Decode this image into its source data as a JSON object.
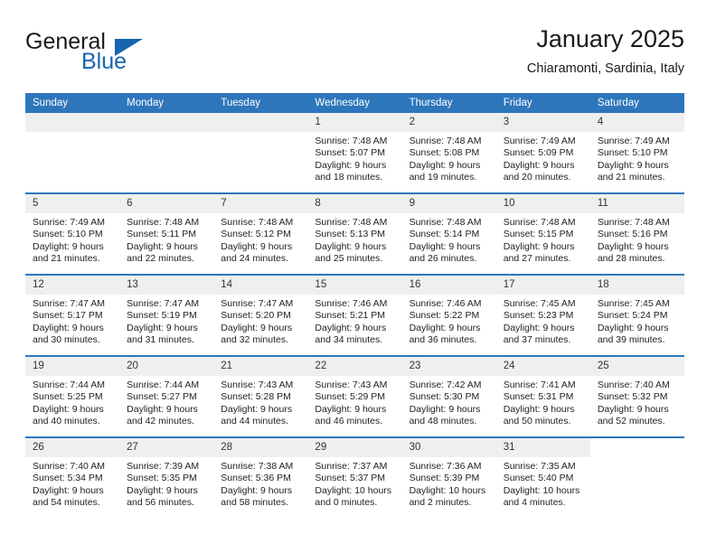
{
  "brand": {
    "name_part1": "General",
    "name_part2": "Blue",
    "accent_color": "#1565b0",
    "triangle_icon": "triangle-icon"
  },
  "header": {
    "month_title": "January 2025",
    "location": "Chiaramonti, Sardinia, Italy"
  },
  "theme": {
    "header_row_color": "#2e76bc",
    "day_band_color": "#efefef",
    "row_divider_color": "#2e76bc",
    "text_color": "#222222"
  },
  "weekday_headers": [
    "Sunday",
    "Monday",
    "Tuesday",
    "Wednesday",
    "Thursday",
    "Friday",
    "Saturday"
  ],
  "weeks": [
    [
      {
        "day": "",
        "blank": true,
        "sunrise": "",
        "sunset": "",
        "daylight_line1": "",
        "daylight_line2": ""
      },
      {
        "day": "",
        "blank": true,
        "sunrise": "",
        "sunset": "",
        "daylight_line1": "",
        "daylight_line2": ""
      },
      {
        "day": "",
        "blank": true,
        "sunrise": "",
        "sunset": "",
        "daylight_line1": "",
        "daylight_line2": ""
      },
      {
        "day": "1",
        "sunrise": "Sunrise: 7:48 AM",
        "sunset": "Sunset: 5:07 PM",
        "daylight_line1": "Daylight: 9 hours",
        "daylight_line2": "and 18 minutes."
      },
      {
        "day": "2",
        "sunrise": "Sunrise: 7:48 AM",
        "sunset": "Sunset: 5:08 PM",
        "daylight_line1": "Daylight: 9 hours",
        "daylight_line2": "and 19 minutes."
      },
      {
        "day": "3",
        "sunrise": "Sunrise: 7:49 AM",
        "sunset": "Sunset: 5:09 PM",
        "daylight_line1": "Daylight: 9 hours",
        "daylight_line2": "and 20 minutes."
      },
      {
        "day": "4",
        "sunrise": "Sunrise: 7:49 AM",
        "sunset": "Sunset: 5:10 PM",
        "daylight_line1": "Daylight: 9 hours",
        "daylight_line2": "and 21 minutes."
      }
    ],
    [
      {
        "day": "5",
        "sunrise": "Sunrise: 7:49 AM",
        "sunset": "Sunset: 5:10 PM",
        "daylight_line1": "Daylight: 9 hours",
        "daylight_line2": "and 21 minutes."
      },
      {
        "day": "6",
        "sunrise": "Sunrise: 7:48 AM",
        "sunset": "Sunset: 5:11 PM",
        "daylight_line1": "Daylight: 9 hours",
        "daylight_line2": "and 22 minutes."
      },
      {
        "day": "7",
        "sunrise": "Sunrise: 7:48 AM",
        "sunset": "Sunset: 5:12 PM",
        "daylight_line1": "Daylight: 9 hours",
        "daylight_line2": "and 24 minutes."
      },
      {
        "day": "8",
        "sunrise": "Sunrise: 7:48 AM",
        "sunset": "Sunset: 5:13 PM",
        "daylight_line1": "Daylight: 9 hours",
        "daylight_line2": "and 25 minutes."
      },
      {
        "day": "9",
        "sunrise": "Sunrise: 7:48 AM",
        "sunset": "Sunset: 5:14 PM",
        "daylight_line1": "Daylight: 9 hours",
        "daylight_line2": "and 26 minutes."
      },
      {
        "day": "10",
        "sunrise": "Sunrise: 7:48 AM",
        "sunset": "Sunset: 5:15 PM",
        "daylight_line1": "Daylight: 9 hours",
        "daylight_line2": "and 27 minutes."
      },
      {
        "day": "11",
        "sunrise": "Sunrise: 7:48 AM",
        "sunset": "Sunset: 5:16 PM",
        "daylight_line1": "Daylight: 9 hours",
        "daylight_line2": "and 28 minutes."
      }
    ],
    [
      {
        "day": "12",
        "sunrise": "Sunrise: 7:47 AM",
        "sunset": "Sunset: 5:17 PM",
        "daylight_line1": "Daylight: 9 hours",
        "daylight_line2": "and 30 minutes."
      },
      {
        "day": "13",
        "sunrise": "Sunrise: 7:47 AM",
        "sunset": "Sunset: 5:19 PM",
        "daylight_line1": "Daylight: 9 hours",
        "daylight_line2": "and 31 minutes."
      },
      {
        "day": "14",
        "sunrise": "Sunrise: 7:47 AM",
        "sunset": "Sunset: 5:20 PM",
        "daylight_line1": "Daylight: 9 hours",
        "daylight_line2": "and 32 minutes."
      },
      {
        "day": "15",
        "sunrise": "Sunrise: 7:46 AM",
        "sunset": "Sunset: 5:21 PM",
        "daylight_line1": "Daylight: 9 hours",
        "daylight_line2": "and 34 minutes."
      },
      {
        "day": "16",
        "sunrise": "Sunrise: 7:46 AM",
        "sunset": "Sunset: 5:22 PM",
        "daylight_line1": "Daylight: 9 hours",
        "daylight_line2": "and 36 minutes."
      },
      {
        "day": "17",
        "sunrise": "Sunrise: 7:45 AM",
        "sunset": "Sunset: 5:23 PM",
        "daylight_line1": "Daylight: 9 hours",
        "daylight_line2": "and 37 minutes."
      },
      {
        "day": "18",
        "sunrise": "Sunrise: 7:45 AM",
        "sunset": "Sunset: 5:24 PM",
        "daylight_line1": "Daylight: 9 hours",
        "daylight_line2": "and 39 minutes."
      }
    ],
    [
      {
        "day": "19",
        "sunrise": "Sunrise: 7:44 AM",
        "sunset": "Sunset: 5:25 PM",
        "daylight_line1": "Daylight: 9 hours",
        "daylight_line2": "and 40 minutes."
      },
      {
        "day": "20",
        "sunrise": "Sunrise: 7:44 AM",
        "sunset": "Sunset: 5:27 PM",
        "daylight_line1": "Daylight: 9 hours",
        "daylight_line2": "and 42 minutes."
      },
      {
        "day": "21",
        "sunrise": "Sunrise: 7:43 AM",
        "sunset": "Sunset: 5:28 PM",
        "daylight_line1": "Daylight: 9 hours",
        "daylight_line2": "and 44 minutes."
      },
      {
        "day": "22",
        "sunrise": "Sunrise: 7:43 AM",
        "sunset": "Sunset: 5:29 PM",
        "daylight_line1": "Daylight: 9 hours",
        "daylight_line2": "and 46 minutes."
      },
      {
        "day": "23",
        "sunrise": "Sunrise: 7:42 AM",
        "sunset": "Sunset: 5:30 PM",
        "daylight_line1": "Daylight: 9 hours",
        "daylight_line2": "and 48 minutes."
      },
      {
        "day": "24",
        "sunrise": "Sunrise: 7:41 AM",
        "sunset": "Sunset: 5:31 PM",
        "daylight_line1": "Daylight: 9 hours",
        "daylight_line2": "and 50 minutes."
      },
      {
        "day": "25",
        "sunrise": "Sunrise: 7:40 AM",
        "sunset": "Sunset: 5:32 PM",
        "daylight_line1": "Daylight: 9 hours",
        "daylight_line2": "and 52 minutes."
      }
    ],
    [
      {
        "day": "26",
        "sunrise": "Sunrise: 7:40 AM",
        "sunset": "Sunset: 5:34 PM",
        "daylight_line1": "Daylight: 9 hours",
        "daylight_line2": "and 54 minutes."
      },
      {
        "day": "27",
        "sunrise": "Sunrise: 7:39 AM",
        "sunset": "Sunset: 5:35 PM",
        "daylight_line1": "Daylight: 9 hours",
        "daylight_line2": "and 56 minutes."
      },
      {
        "day": "28",
        "sunrise": "Sunrise: 7:38 AM",
        "sunset": "Sunset: 5:36 PM",
        "daylight_line1": "Daylight: 9 hours",
        "daylight_line2": "and 58 minutes."
      },
      {
        "day": "29",
        "sunrise": "Sunrise: 7:37 AM",
        "sunset": "Sunset: 5:37 PM",
        "daylight_line1": "Daylight: 10 hours",
        "daylight_line2": "and 0 minutes."
      },
      {
        "day": "30",
        "sunrise": "Sunrise: 7:36 AM",
        "sunset": "Sunset: 5:39 PM",
        "daylight_line1": "Daylight: 10 hours",
        "daylight_line2": "and 2 minutes."
      },
      {
        "day": "31",
        "sunrise": "Sunrise: 7:35 AM",
        "sunset": "Sunset: 5:40 PM",
        "daylight_line1": "Daylight: 10 hours",
        "daylight_line2": "and 4 minutes."
      },
      {
        "day": "",
        "blank": true,
        "sunrise": "",
        "sunset": "",
        "daylight_line1": "",
        "daylight_line2": ""
      }
    ]
  ]
}
